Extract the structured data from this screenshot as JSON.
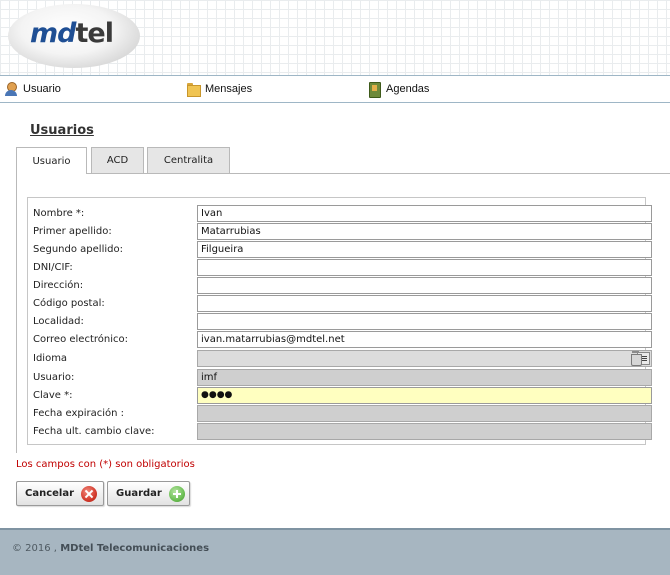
{
  "brand": {
    "logo_md": "md",
    "logo_tel": "tel"
  },
  "nav": {
    "items": [
      {
        "label": "Usuario",
        "icon": "user-icon"
      },
      {
        "label": "Mensajes",
        "icon": "folder-icon"
      },
      {
        "label": "Agendas",
        "icon": "book-icon"
      }
    ]
  },
  "page": {
    "title": "Usuarios"
  },
  "tabs": [
    {
      "label": "Usuario",
      "active": true
    },
    {
      "label": "ACD",
      "active": false
    },
    {
      "label": "Centralita",
      "active": false
    }
  ],
  "form": {
    "fields": [
      {
        "label": "Nombre *:",
        "value": "Ivan"
      },
      {
        "label": "Primer apellido:",
        "value": "Matarrubias"
      },
      {
        "label": "Segundo apellido:",
        "value": "Filgueira"
      },
      {
        "label": "DNI/CIF:",
        "value": ""
      },
      {
        "label": "Dirección:",
        "value": ""
      },
      {
        "label": "Código postal:",
        "value": ""
      },
      {
        "label": "Localidad:",
        "value": ""
      },
      {
        "label": "Correo electrónico:",
        "value": "ivan.matarrubias@mdtel.net"
      },
      {
        "label": "Idioma",
        "value": ""
      },
      {
        "label": "Usuario:",
        "value": "imf"
      },
      {
        "label": "Clave *:",
        "value": "●●●●"
      },
      {
        "label": "Fecha expiración :",
        "value": ""
      },
      {
        "label": "Fecha ult. cambio clave:",
        "value": ""
      }
    ],
    "required_note": "Los campos con (*) son obligatorios"
  },
  "buttons": {
    "cancel": "Cancelar",
    "save": "Guardar"
  },
  "footer": {
    "copyright": "© 2016 ,",
    "company": "MDtel Telecomunicaciones"
  },
  "colors": {
    "accent": "#1f4f94",
    "required": "#c00000",
    "footer_bg": "#a7b6c1",
    "password_bg": "#ffffc0"
  }
}
